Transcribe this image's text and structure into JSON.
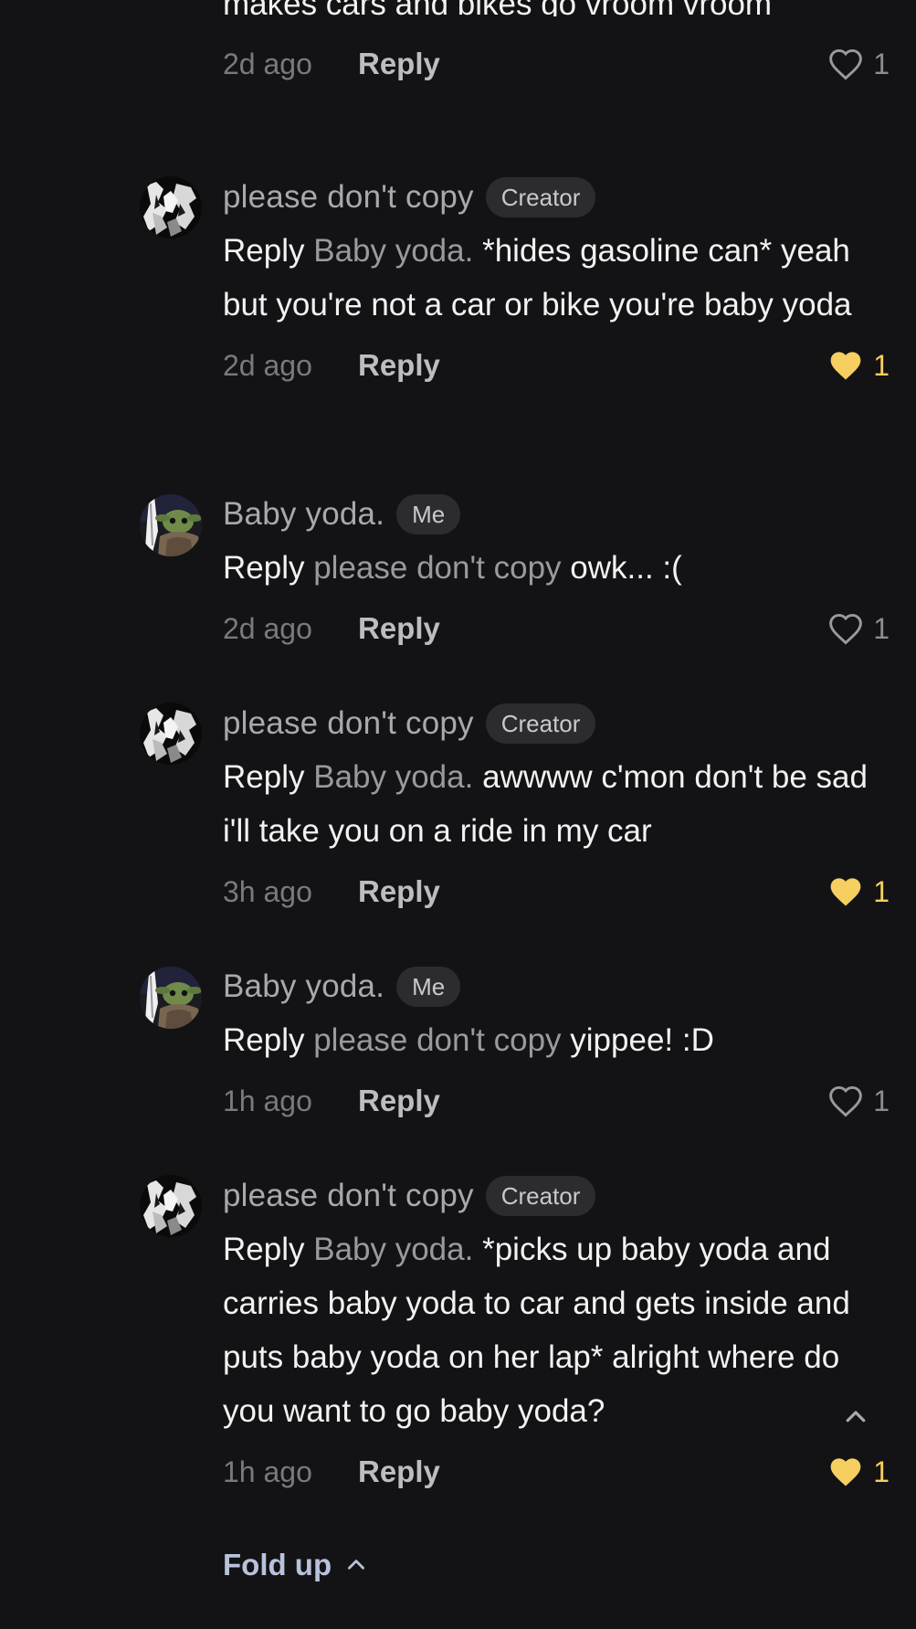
{
  "thread": {
    "first_comment_tail": "makes cars and bikes go vroom vroom",
    "first_comment_time": "2d ago",
    "first_comment_reply": "Reply",
    "first_comment_likes": "1",
    "comments": [
      {
        "username": "please don't copy",
        "badge": "Creator",
        "lead": "Reply",
        "mention": "Baby yoda.",
        "text": "*hides gasoline can* yeah but you're not a car or bike you're baby yoda",
        "time": "2d ago",
        "reply_label": "Reply",
        "likes": "1",
        "liked": true
      },
      {
        "username": "Baby yoda.",
        "badge": "Me",
        "lead": "Reply",
        "mention": "please don't copy",
        "text": "owk... :(",
        "time": "2d ago",
        "reply_label": "Reply",
        "likes": "1",
        "liked": false
      },
      {
        "username": "please don't copy",
        "badge": "Creator",
        "lead": "Reply",
        "mention": "Baby yoda.",
        "text": "awwww c'mon don't be sad i'll take you on a ride in my car",
        "time": "3h ago",
        "reply_label": "Reply",
        "likes": "1",
        "liked": true
      },
      {
        "username": "Baby yoda.",
        "badge": "Me",
        "lead": "Reply",
        "mention": "please don't copy",
        "text": "yippee! :D",
        "time": "1h ago",
        "reply_label": "Reply",
        "likes": "1",
        "liked": false
      },
      {
        "username": "please don't copy",
        "badge": "Creator",
        "lead": "Reply",
        "mention": "Baby yoda.",
        "text": "*picks up baby yoda and carries baby yoda to car and gets inside and puts baby yoda on her lap* alright where do you want to go baby yoda?",
        "time": "1h ago",
        "reply_label": "Reply",
        "likes": "1",
        "liked": true
      }
    ],
    "fold_up_label": "Fold up"
  },
  "colors": {
    "background": "#131315",
    "liked_heart": "#f6cf60",
    "unliked_heart": "#9a9a9e",
    "fold_up_text": "#b8c2dc"
  },
  "icons": {
    "like": "heart-icon",
    "collapse": "chevron-up-icon"
  }
}
